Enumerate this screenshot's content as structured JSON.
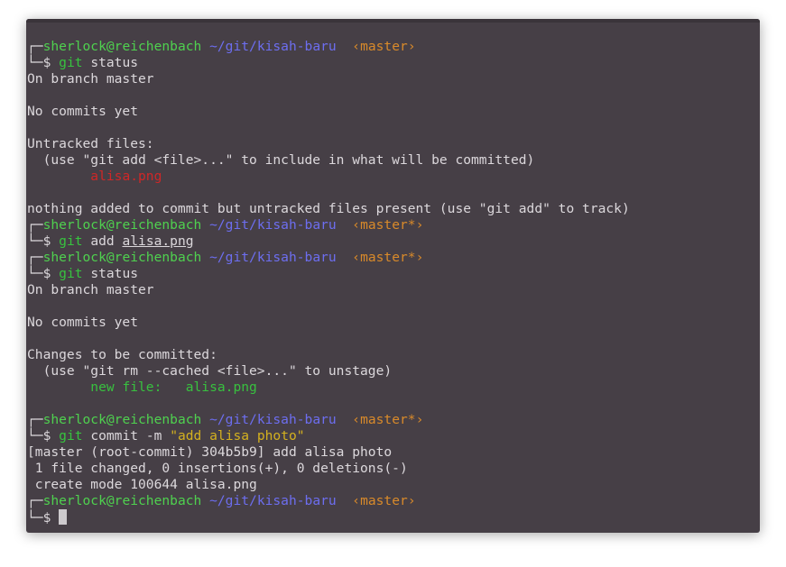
{
  "prompt": {
    "corner_top": "┌─",
    "corner_bottom": "└─",
    "user_host": "sherlock@reichenbach",
    "path": "~/git/kisah-baru",
    "dollar": "$"
  },
  "lines": [
    {
      "type": "prompt",
      "branch": "‹master›"
    },
    {
      "type": "cmd",
      "git": "git",
      "rest": " status"
    },
    {
      "type": "text",
      "text": "On branch master"
    },
    {
      "type": "blank"
    },
    {
      "type": "text",
      "text": "No commits yet"
    },
    {
      "type": "blank"
    },
    {
      "type": "text",
      "text": "Untracked files:"
    },
    {
      "type": "text",
      "text": "  (use \"git add <file>...\" to include in what will be committed)"
    },
    {
      "type": "file_red",
      "indent": "        ",
      "file": "alisa.png"
    },
    {
      "type": "blank"
    },
    {
      "type": "text",
      "text": "nothing added to commit but untracked files present (use \"git add\" to track)"
    },
    {
      "type": "prompt",
      "branch": "‹master*›"
    },
    {
      "type": "cmd_add",
      "git": "git",
      "mid": " add ",
      "file": "alisa.png"
    },
    {
      "type": "prompt",
      "branch": "‹master*›"
    },
    {
      "type": "cmd",
      "git": "git",
      "rest": " status"
    },
    {
      "type": "text",
      "text": "On branch master"
    },
    {
      "type": "blank"
    },
    {
      "type": "text",
      "text": "No commits yet"
    },
    {
      "type": "blank"
    },
    {
      "type": "text",
      "text": "Changes to be committed:"
    },
    {
      "type": "text",
      "text": "  (use \"git rm --cached <file>...\" to unstage)"
    },
    {
      "type": "newfile",
      "indent": "        ",
      "label": "new file:   ",
      "file": "alisa.png"
    },
    {
      "type": "blank"
    },
    {
      "type": "prompt",
      "branch": "‹master*›"
    },
    {
      "type": "cmd_commit",
      "git": "git",
      "mid": " commit -m ",
      "msg": "\"add alisa photo\""
    },
    {
      "type": "text",
      "text": "[master (root-commit) 304b5b9] add alisa photo"
    },
    {
      "type": "text",
      "text": " 1 file changed, 0 insertions(+), 0 deletions(-)"
    },
    {
      "type": "text",
      "text": " create mode 100644 alisa.png"
    },
    {
      "type": "prompt",
      "branch": "‹master›"
    },
    {
      "type": "cursor"
    }
  ]
}
